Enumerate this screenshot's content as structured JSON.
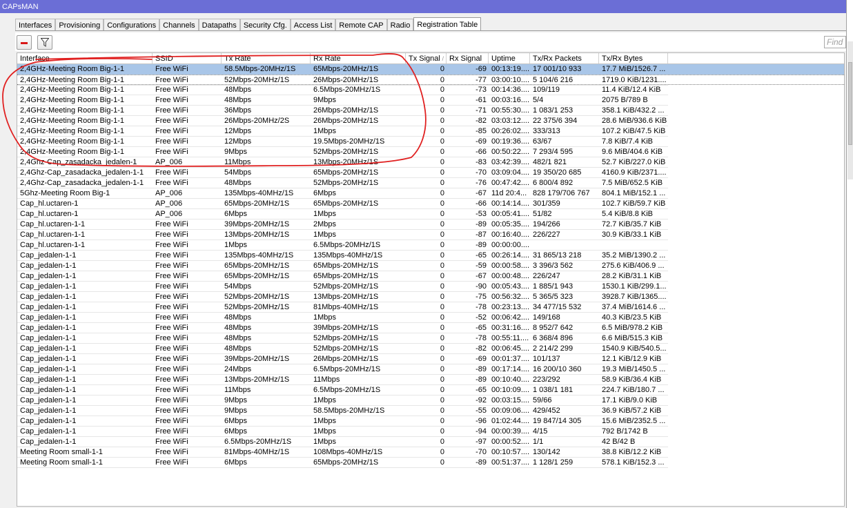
{
  "window": {
    "title": "CAPsMAN"
  },
  "tabs": [
    "Interfaces",
    "Provisioning",
    "Configurations",
    "Channels",
    "Datapaths",
    "Security Cfg.",
    "Access List",
    "Remote CAP",
    "Radio",
    "Registration Table"
  ],
  "active_tab": "Registration Table",
  "toolbar": {
    "find_placeholder": "Find"
  },
  "columns": [
    "Interface",
    "SSID",
    "Tx Rate",
    "Rx Rate",
    "Tx Signal",
    "Rx Signal",
    "Uptime",
    "Tx/Rx Packets",
    "Tx/Rx Bytes"
  ],
  "rows": [
    [
      "2,4GHz-Meeting Room Big-1-1",
      "Free WiFi",
      "58.5Mbps-20MHz/1S",
      "65Mbps-20MHz/1S",
      "0",
      "-69",
      "00:13:19....",
      "17 001/10 933",
      "17.7 MiB/1526.7 ..."
    ],
    [
      "2,4GHz-Meeting Room Big-1-1",
      "Free WiFi",
      "52Mbps-20MHz/1S",
      "26Mbps-20MHz/1S",
      "0",
      "-77",
      "03:00:10....",
      "5 104/6 216",
      "1719.0 KiB/1231...."
    ],
    [
      "2,4GHz-Meeting Room Big-1-1",
      "Free WiFi",
      "48Mbps",
      "6.5Mbps-20MHz/1S",
      "0",
      "-73",
      "00:14:36....",
      "109/119",
      "11.4 KiB/12.4 KiB"
    ],
    [
      "2,4GHz-Meeting Room Big-1-1",
      "Free WiFi",
      "48Mbps",
      "9Mbps",
      "0",
      "-61",
      "00:03:16....",
      "5/4",
      "2075 B/789 B"
    ],
    [
      "2,4GHz-Meeting Room Big-1-1",
      "Free WiFi",
      "36Mbps",
      "26Mbps-20MHz/1S",
      "0",
      "-71",
      "00:55:30....",
      "1 083/1 253",
      "358.1 KiB/432.2 ..."
    ],
    [
      "2,4GHz-Meeting Room Big-1-1",
      "Free WiFi",
      "26Mbps-20MHz/2S",
      "26Mbps-20MHz/1S",
      "0",
      "-82",
      "03:03:12....",
      "22 375/6 394",
      "28.6 MiB/936.6 KiB"
    ],
    [
      "2,4GHz-Meeting Room Big-1-1",
      "Free WiFi",
      "12Mbps",
      "1Mbps",
      "0",
      "-85",
      "00:26:02....",
      "333/313",
      "107.2 KiB/47.5 KiB"
    ],
    [
      "2,4GHz-Meeting Room Big-1-1",
      "Free WiFi",
      "12Mbps",
      "19.5Mbps-20MHz/1S",
      "0",
      "-69",
      "00:19:36....",
      "63/67",
      "7.8 KiB/7.4 KiB"
    ],
    [
      "2,4GHz-Meeting Room Big-1-1",
      "Free WiFi",
      "9Mbps",
      "52Mbps-20MHz/1S",
      "0",
      "-66",
      "00:50:22....",
      "7 293/4 595",
      "9.6 MiB/404.6 KiB"
    ],
    [
      "2,4Ghz-Cap_zasadacka_jedalen-1",
      "AP_006",
      "11Mbps",
      "13Mbps-20MHz/1S",
      "0",
      "-83",
      "03:42:39....",
      "482/1 821",
      "52.7 KiB/227.0 KiB"
    ],
    [
      "2,4Ghz-Cap_zasadacka_jedalen-1-1",
      "Free WiFi",
      "54Mbps",
      "65Mbps-20MHz/1S",
      "0",
      "-70",
      "03:09:04....",
      "19 350/20 685",
      "4160.9 KiB/2371...."
    ],
    [
      "2,4Ghz-Cap_zasadacka_jedalen-1-1",
      "Free WiFi",
      "48Mbps",
      "52Mbps-20MHz/1S",
      "0",
      "-76",
      "00:47:42....",
      "6 800/4 892",
      "7.5 MiB/652.5 KiB"
    ],
    [
      "5Ghz-Meeting Room Big-1",
      "AP_006",
      "135Mbps-40MHz/1S",
      "6Mbps",
      "0",
      "-67",
      "11d 20:4...",
      "828 179/706 767",
      "804.1 MiB/152.1 ..."
    ],
    [
      "Cap_hl.uctaren-1",
      "AP_006",
      "65Mbps-20MHz/1S",
      "65Mbps-20MHz/1S",
      "0",
      "-66",
      "00:14:14....",
      "301/359",
      "102.7 KiB/59.7 KiB"
    ],
    [
      "Cap_hl.uctaren-1",
      "AP_006",
      "6Mbps",
      "1Mbps",
      "0",
      "-53",
      "00:05:41....",
      "51/82",
      "5.4 KiB/8.8 KiB"
    ],
    [
      "Cap_hl.uctaren-1-1",
      "Free WiFi",
      "39Mbps-20MHz/1S",
      "2Mbps",
      "0",
      "-89",
      "00:05:35....",
      "194/266",
      "72.7 KiB/35.7 KiB"
    ],
    [
      "Cap_hl.uctaren-1-1",
      "Free WiFi",
      "13Mbps-20MHz/1S",
      "1Mbps",
      "0",
      "-87",
      "00:16:40....",
      "226/227",
      "30.9 KiB/33.1 KiB"
    ],
    [
      "Cap_hl.uctaren-1-1",
      "Free WiFi",
      "1Mbps",
      "6.5Mbps-20MHz/1S",
      "0",
      "-89",
      "00:00:00....",
      "",
      ""
    ],
    [
      "Cap_jedalen-1-1",
      "Free WiFi",
      "135Mbps-40MHz/1S",
      "135Mbps-40MHz/1S",
      "0",
      "-65",
      "00:26:14....",
      "31 865/13 218",
      "35.2 MiB/1390.2 ..."
    ],
    [
      "Cap_jedalen-1-1",
      "Free WiFi",
      "65Mbps-20MHz/1S",
      "65Mbps-20MHz/1S",
      "0",
      "-59",
      "00:00:58....",
      "3 396/3 562",
      "275.6 KiB/406.9 ..."
    ],
    [
      "Cap_jedalen-1-1",
      "Free WiFi",
      "65Mbps-20MHz/1S",
      "65Mbps-20MHz/1S",
      "0",
      "-67",
      "00:00:48....",
      "226/247",
      "28.2 KiB/31.1 KiB"
    ],
    [
      "Cap_jedalen-1-1",
      "Free WiFi",
      "54Mbps",
      "52Mbps-20MHz/1S",
      "0",
      "-90",
      "00:05:43....",
      "1 885/1 943",
      "1530.1 KiB/299.1..."
    ],
    [
      "Cap_jedalen-1-1",
      "Free WiFi",
      "52Mbps-20MHz/1S",
      "13Mbps-20MHz/1S",
      "0",
      "-75",
      "00:56:32....",
      "5 365/5 323",
      "3928.7 KiB/1365...."
    ],
    [
      "Cap_jedalen-1-1",
      "Free WiFi",
      "52Mbps-20MHz/1S",
      "81Mbps-40MHz/1S",
      "0",
      "-78",
      "00:23:13....",
      "34 477/15 532",
      "37.4 MiB/1614.6 ..."
    ],
    [
      "Cap_jedalen-1-1",
      "Free WiFi",
      "48Mbps",
      "1Mbps",
      "0",
      "-52",
      "00:06:42....",
      "149/168",
      "40.3 KiB/23.5 KiB"
    ],
    [
      "Cap_jedalen-1-1",
      "Free WiFi",
      "48Mbps",
      "39Mbps-20MHz/1S",
      "0",
      "-65",
      "00:31:16....",
      "8 952/7 642",
      "6.5 MiB/978.2 KiB"
    ],
    [
      "Cap_jedalen-1-1",
      "Free WiFi",
      "48Mbps",
      "52Mbps-20MHz/1S",
      "0",
      "-78",
      "00:55:11....",
      "6 368/4 896",
      "6.6 MiB/515.3 KiB"
    ],
    [
      "Cap_jedalen-1-1",
      "Free WiFi",
      "48Mbps",
      "52Mbps-20MHz/1S",
      "0",
      "-82",
      "00:06:45....",
      "2 214/2 299",
      "1540.9 KiB/540.5..."
    ],
    [
      "Cap_jedalen-1-1",
      "Free WiFi",
      "39Mbps-20MHz/1S",
      "26Mbps-20MHz/1S",
      "0",
      "-69",
      "00:01:37....",
      "101/137",
      "12.1 KiB/12.9 KiB"
    ],
    [
      "Cap_jedalen-1-1",
      "Free WiFi",
      "24Mbps",
      "6.5Mbps-20MHz/1S",
      "0",
      "-89",
      "00:17:14....",
      "16 200/10 360",
      "19.3 MiB/1450.5 ..."
    ],
    [
      "Cap_jedalen-1-1",
      "Free WiFi",
      "13Mbps-20MHz/1S",
      "11Mbps",
      "0",
      "-89",
      "00:10:40....",
      "223/292",
      "58.9 KiB/36.4 KiB"
    ],
    [
      "Cap_jedalen-1-1",
      "Free WiFi",
      "11Mbps",
      "6.5Mbps-20MHz/1S",
      "0",
      "-65",
      "00:10:09....",
      "1 038/1 181",
      "224.7 KiB/180.7 ..."
    ],
    [
      "Cap_jedalen-1-1",
      "Free WiFi",
      "9Mbps",
      "1Mbps",
      "0",
      "-92",
      "00:03:15....",
      "59/66",
      "17.1 KiB/9.0 KiB"
    ],
    [
      "Cap_jedalen-1-1",
      "Free WiFi",
      "9Mbps",
      "58.5Mbps-20MHz/1S",
      "0",
      "-55",
      "00:09:06....",
      "429/452",
      "36.9 KiB/57.2 KiB"
    ],
    [
      "Cap_jedalen-1-1",
      "Free WiFi",
      "6Mbps",
      "1Mbps",
      "0",
      "-96",
      "01:02:44....",
      "19 847/14 305",
      "15.6 MiB/2352.5 ..."
    ],
    [
      "Cap_jedalen-1-1",
      "Free WiFi",
      "6Mbps",
      "1Mbps",
      "0",
      "-94",
      "00:00:39....",
      "4/15",
      "792 B/1742 B"
    ],
    [
      "Cap_jedalen-1-1",
      "Free WiFi",
      "6.5Mbps-20MHz/1S",
      "1Mbps",
      "0",
      "-97",
      "00:00:52....",
      "1/1",
      "42 B/42 B"
    ],
    [
      "Meeting Room small-1-1",
      "Free WiFi",
      "81Mbps-40MHz/1S",
      "108Mbps-40MHz/1S",
      "0",
      "-70",
      "00:10:57....",
      "130/142",
      "38.8 KiB/12.2 KiB"
    ],
    [
      "Meeting Room small-1-1",
      "Free WiFi",
      "6Mbps",
      "65Mbps-20MHz/1S",
      "0",
      "-89",
      "00:51:37....",
      "1 128/1 259",
      "578.1 KiB/152.3 ..."
    ]
  ],
  "selected_row": 0,
  "sort_column": "Tx Signal",
  "colors": {
    "titlebar": "#6b6ed6",
    "selection": "#a9c6e8",
    "annotation": "#e02020"
  }
}
